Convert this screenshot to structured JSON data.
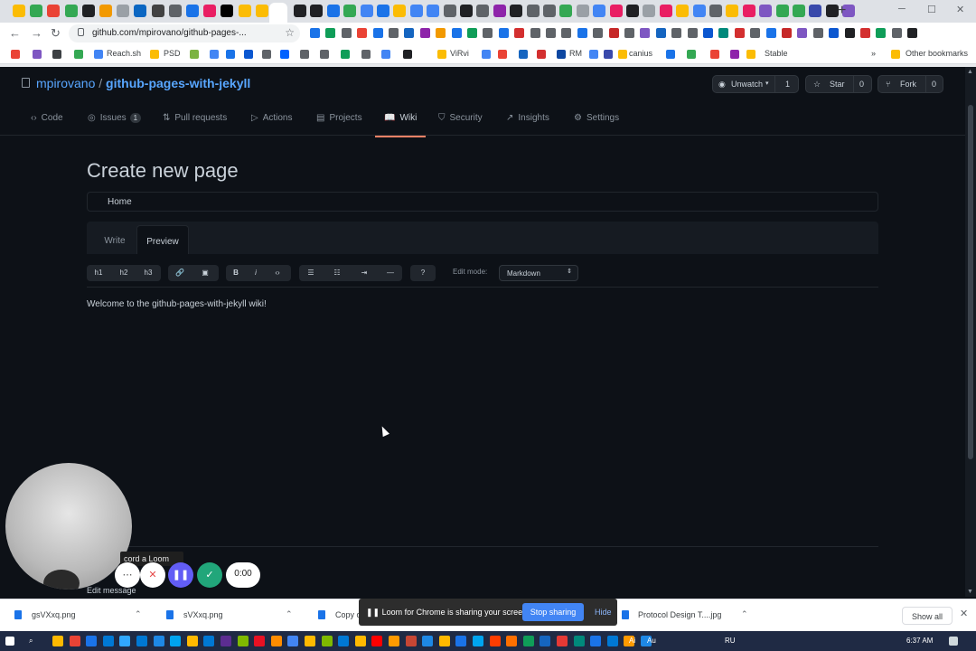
{
  "browser": {
    "url": "github.com/mpirovano/github-pages-...",
    "bookmarks": [
      "Reach.sh",
      "PSD",
      "ViRvi",
      "RM",
      "canius",
      "Stable"
    ],
    "other_bookmarks": "Other bookmarks"
  },
  "repo": {
    "owner": "mpirovano",
    "separator": "/",
    "name": "github-pages-with-jekyll",
    "unwatch_label": "Unwatch",
    "unwatch_count": "1",
    "star_label": "Star",
    "star_count": "0",
    "fork_label": "Fork",
    "fork_count": "0"
  },
  "tabs": [
    {
      "label": "Code",
      "icon": "code-icon"
    },
    {
      "label": "Issues",
      "icon": "issue-icon",
      "count": "1"
    },
    {
      "label": "Pull requests",
      "icon": "pull-request-icon"
    },
    {
      "label": "Actions",
      "icon": "play-icon"
    },
    {
      "label": "Projects",
      "icon": "project-icon"
    },
    {
      "label": "Wiki",
      "icon": "book-icon",
      "active": true
    },
    {
      "label": "Security",
      "icon": "shield-icon"
    },
    {
      "label": "Insights",
      "icon": "graph-icon"
    },
    {
      "label": "Settings",
      "icon": "gear-icon"
    }
  ],
  "page": {
    "title": "Create new page",
    "name_value": "Home",
    "write_tab": "Write",
    "preview_tab": "Preview",
    "toolbar": [
      "h1",
      "h2",
      "h3",
      "B",
      "i"
    ],
    "edit_mode_label": "Edit mode:",
    "edit_mode_value": "Markdown",
    "preview_text": "Welcome to the github-pages-with-jekyll wiki!",
    "edit_message_label": "Edit message"
  },
  "loom": {
    "tooltip": "cord a Loom",
    "timer": "0:00",
    "sharing_text": "Loom for Chrome is sharing your screen.",
    "stop_label": "Stop sharing",
    "hide_label": "Hide"
  },
  "downloads": {
    "items": [
      "gsVXxq.png",
      "sVXxq.png",
      "Copy c",
      "Protocol Design T....jpg"
    ],
    "show_all": "Show all"
  },
  "taskbar": {
    "time": "6:37 AM",
    "apps": [
      "Ai",
      "Au",
      "RU",
      "Ae"
    ]
  }
}
